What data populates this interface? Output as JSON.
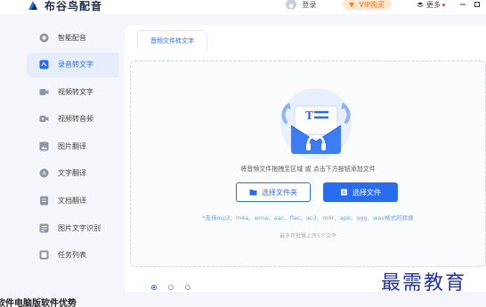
{
  "app": {
    "name": "布谷鸟配音",
    "login_label": "登录",
    "vip_label": "VIP购买",
    "more_label": "更多"
  },
  "sidebar": {
    "items": [
      {
        "label": "智能配音",
        "icon": "robot-icon",
        "active": false
      },
      {
        "label": "录音转文字",
        "icon": "recording-icon",
        "active": true
      },
      {
        "label": "视频转文字",
        "icon": "video-icon",
        "active": false
      },
      {
        "label": "视频转音频",
        "icon": "video-audio-icon",
        "active": false
      },
      {
        "label": "图片翻译",
        "icon": "image-icon",
        "active": false
      },
      {
        "label": "文字翻译",
        "icon": "translate-icon",
        "active": false
      },
      {
        "label": "文档翻译",
        "icon": "document-icon",
        "active": false
      },
      {
        "label": "图片文字识别",
        "icon": "ocr-icon",
        "active": false
      },
      {
        "label": "任务列表",
        "icon": "task-list-icon",
        "active": false
      }
    ]
  },
  "main": {
    "tab_label": "音频文件转文字",
    "drop_hint": "将音频文件拖拽至区域 或 点击下方按钮添加文件",
    "select_folder_label": "选择文件夹",
    "select_file_label": "选择文件",
    "formats_text": "*支持mp3、m4a、wma、aac、flac、ac3、m4r、ape、ogg、wav格式的转换",
    "limit_text": "最多可批量上传5个文件"
  },
  "watermark_text": "最需教育",
  "caption_text": "软件电脑版软件优势",
  "colors": {
    "accent": "#2a6cf0",
    "vip_bg": "#ffe8cf",
    "vip_text": "#e97320",
    "watermark": "#2533a0"
  }
}
